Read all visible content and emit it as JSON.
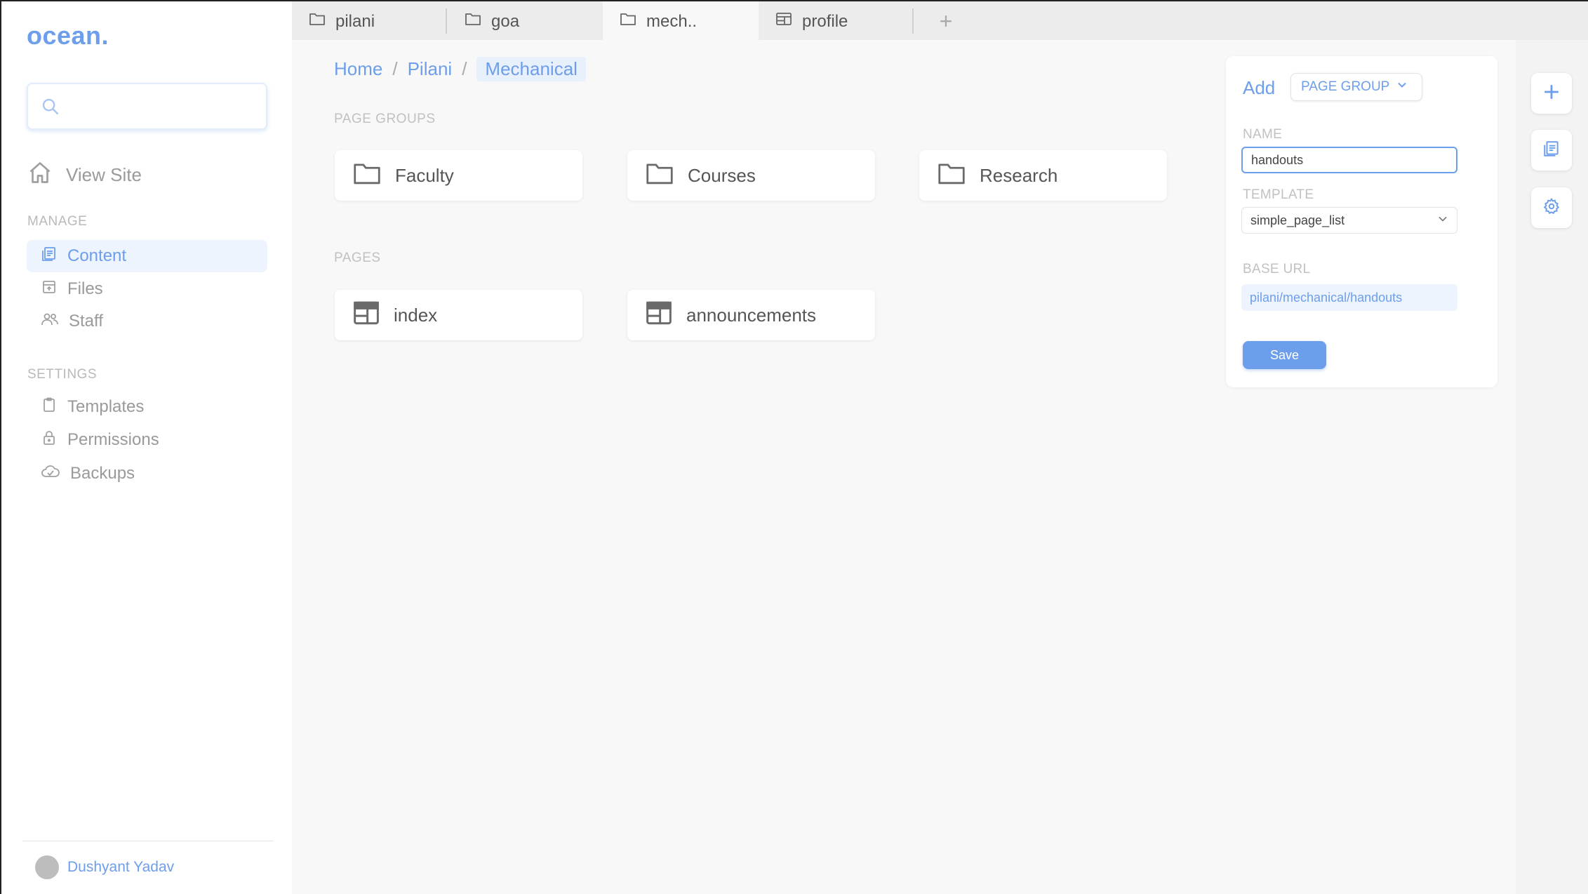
{
  "app": {
    "logo": "ocean."
  },
  "sidebar": {
    "search_placeholder": "",
    "view_site": "View Site",
    "manage_label": "MANAGE",
    "manage_items": [
      {
        "label": "Content",
        "icon": "content-icon",
        "active": true
      },
      {
        "label": "Files",
        "icon": "files-icon",
        "active": false
      },
      {
        "label": "Staff",
        "icon": "staff-icon",
        "active": false
      }
    ],
    "settings_label": "SETTINGS",
    "settings_items": [
      {
        "label": "Templates",
        "icon": "clipboard-icon"
      },
      {
        "label": "Permissions",
        "icon": "lock-icon"
      },
      {
        "label": "Backups",
        "icon": "cloud-check-icon"
      }
    ],
    "user_name": "Dushyant Yadav"
  },
  "tabs": [
    {
      "label": "pilani",
      "icon": "folder-icon",
      "active": false
    },
    {
      "label": "goa",
      "icon": "folder-icon",
      "active": false
    },
    {
      "label": "mech..",
      "icon": "folder-icon",
      "active": true
    },
    {
      "label": "profile",
      "icon": "page-icon",
      "active": false
    }
  ],
  "tab_add": "+",
  "breadcrumb": {
    "items": [
      "Home",
      "Pilani",
      "Mechanical"
    ],
    "separator": "/"
  },
  "main": {
    "page_groups_label": "PAGE GROUPS",
    "page_groups": [
      "Faculty",
      "Courses",
      "Research"
    ],
    "pages_label": "PAGES",
    "pages": [
      "index",
      "announcements"
    ]
  },
  "panel": {
    "add_label": "Add",
    "type_value": "PAGE GROUP",
    "name_label": "NAME",
    "name_value": "handouts",
    "template_label": "TEMPLATE",
    "template_value": "simple_page_list",
    "base_url_label": "BASE URL",
    "base_url_value": "pilani/mechanical/handouts",
    "save_label": "Save"
  },
  "colors": {
    "accent": "#6d9eeb",
    "muted_text": "#9a9a9a",
    "active_bg": "#eef4fd"
  }
}
